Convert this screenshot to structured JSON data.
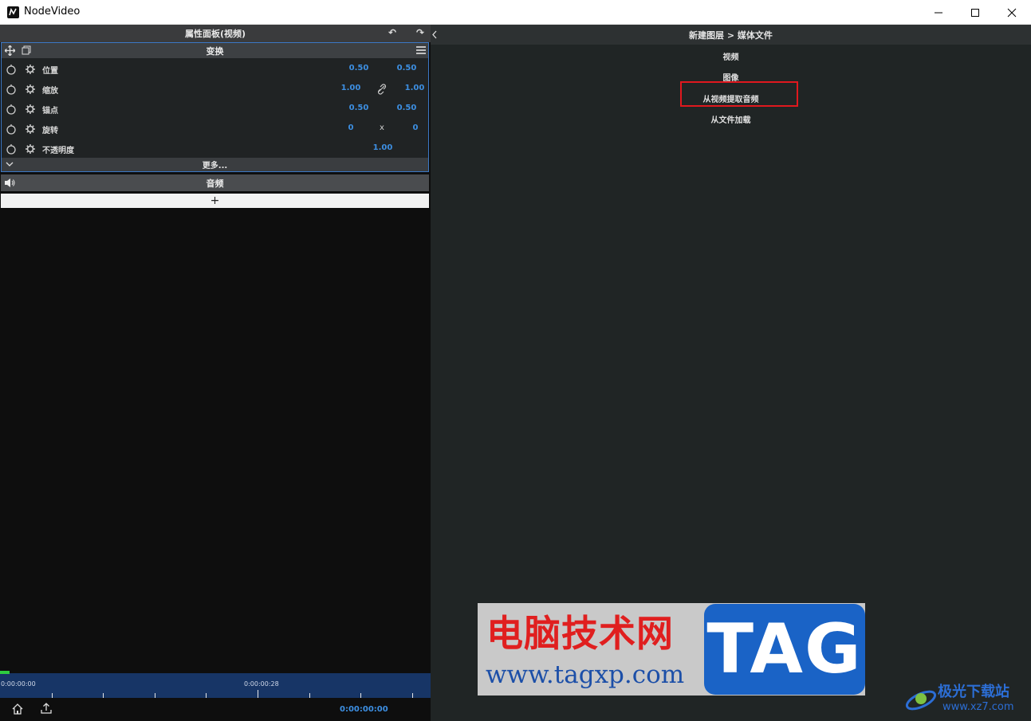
{
  "window": {
    "title": "NodeVideo"
  },
  "left_panel": {
    "header": "属性面板(视频)",
    "transform": {
      "title": "变换",
      "rows": [
        {
          "label": "位置",
          "v1": "0.50",
          "mid": "",
          "v2": "0.50"
        },
        {
          "label": "缩放",
          "v1": "1.00",
          "mid": "link-icon",
          "v2": "1.00"
        },
        {
          "label": "锚点",
          "v1": "0.50",
          "mid": "",
          "v2": "0.50"
        },
        {
          "label": "旋转",
          "v1": "0",
          "mid": "x",
          "v2": "0"
        },
        {
          "label": "不透明度",
          "v1": "",
          "mid": "",
          "v2": "1.00"
        }
      ],
      "more": "更多..."
    },
    "audio": "音频",
    "add": "+"
  },
  "timeline": {
    "start": "0:00:00:00",
    "mark": "0:00:00:28",
    "timecode": "0:00:00:00"
  },
  "right_panel": {
    "breadcrumb": "新建图层 > 媒体文件",
    "items": [
      "视频",
      "图像",
      "从视频提取音频",
      "从文件加载"
    ]
  },
  "watermark": {
    "cn": "电脑技术网",
    "url": "www.tagxp.com",
    "tag": "TAG",
    "site_cn": "极光下载站",
    "site_url": "www.xz7.com"
  },
  "colors": {
    "accent": "#3d8fe2",
    "highlight": "#e0181e",
    "timeline": "#173566"
  }
}
